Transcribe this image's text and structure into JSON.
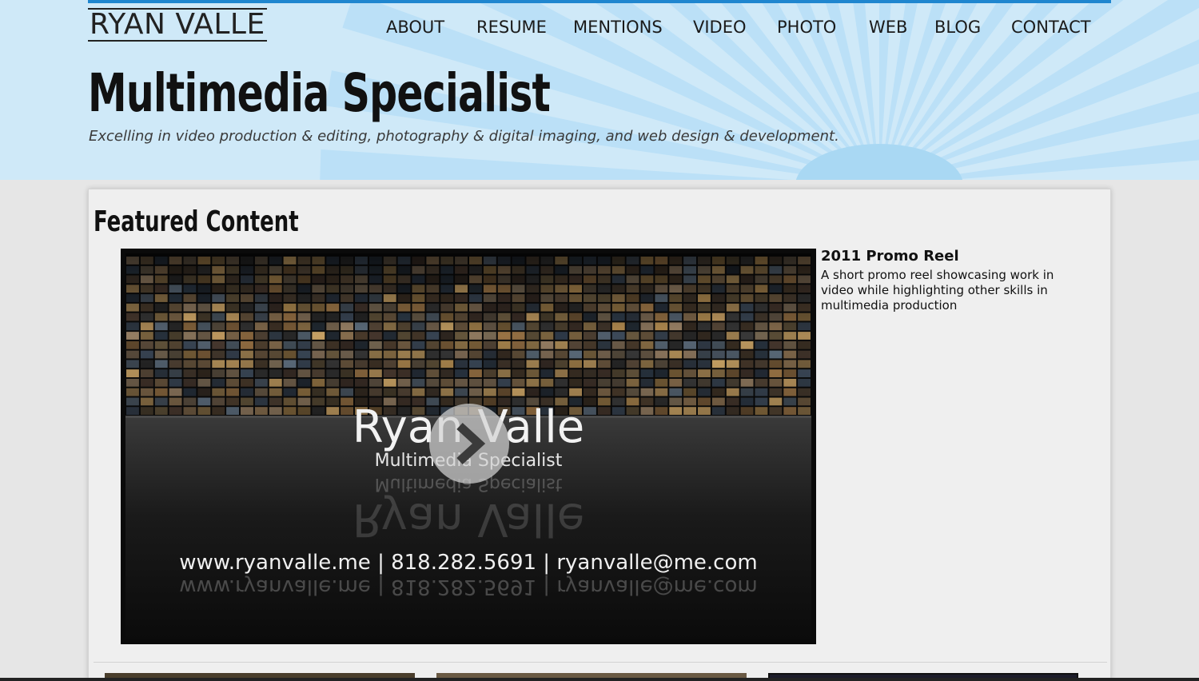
{
  "site": {
    "logo": "RYAN VALLE",
    "headline": "Multimedia Specialist",
    "tagline": "Excelling in video production & editing, photography & digital imaging, and web design & development."
  },
  "nav": {
    "items": [
      {
        "label": "ABOUT"
      },
      {
        "label": "RESUME"
      },
      {
        "label": "MENTIONS"
      },
      {
        "label": "VIDEO"
      },
      {
        "label": "PHOTO"
      },
      {
        "label": "WEB"
      },
      {
        "label": "BLOG"
      },
      {
        "label": "CONTACT"
      }
    ]
  },
  "featured": {
    "section_title": "Featured Content",
    "video": {
      "brand": "Ryan Valle",
      "role": "Multimedia Specialist",
      "contact": "www.ryanvalle.me | 818.282.5691 | ryanvalle@me.com",
      "play_icon": "play-chevron-icon"
    },
    "item_title": "2011 Promo Reel",
    "item_description": "A short promo reel showcasing work in video while highlighting other skills in multimedia production"
  },
  "colors": {
    "header_bg": "#cfe9f8",
    "accent_bar": "#1f86cf",
    "page_bg": "#e6e6e6",
    "panel_bg": "#efefef"
  }
}
